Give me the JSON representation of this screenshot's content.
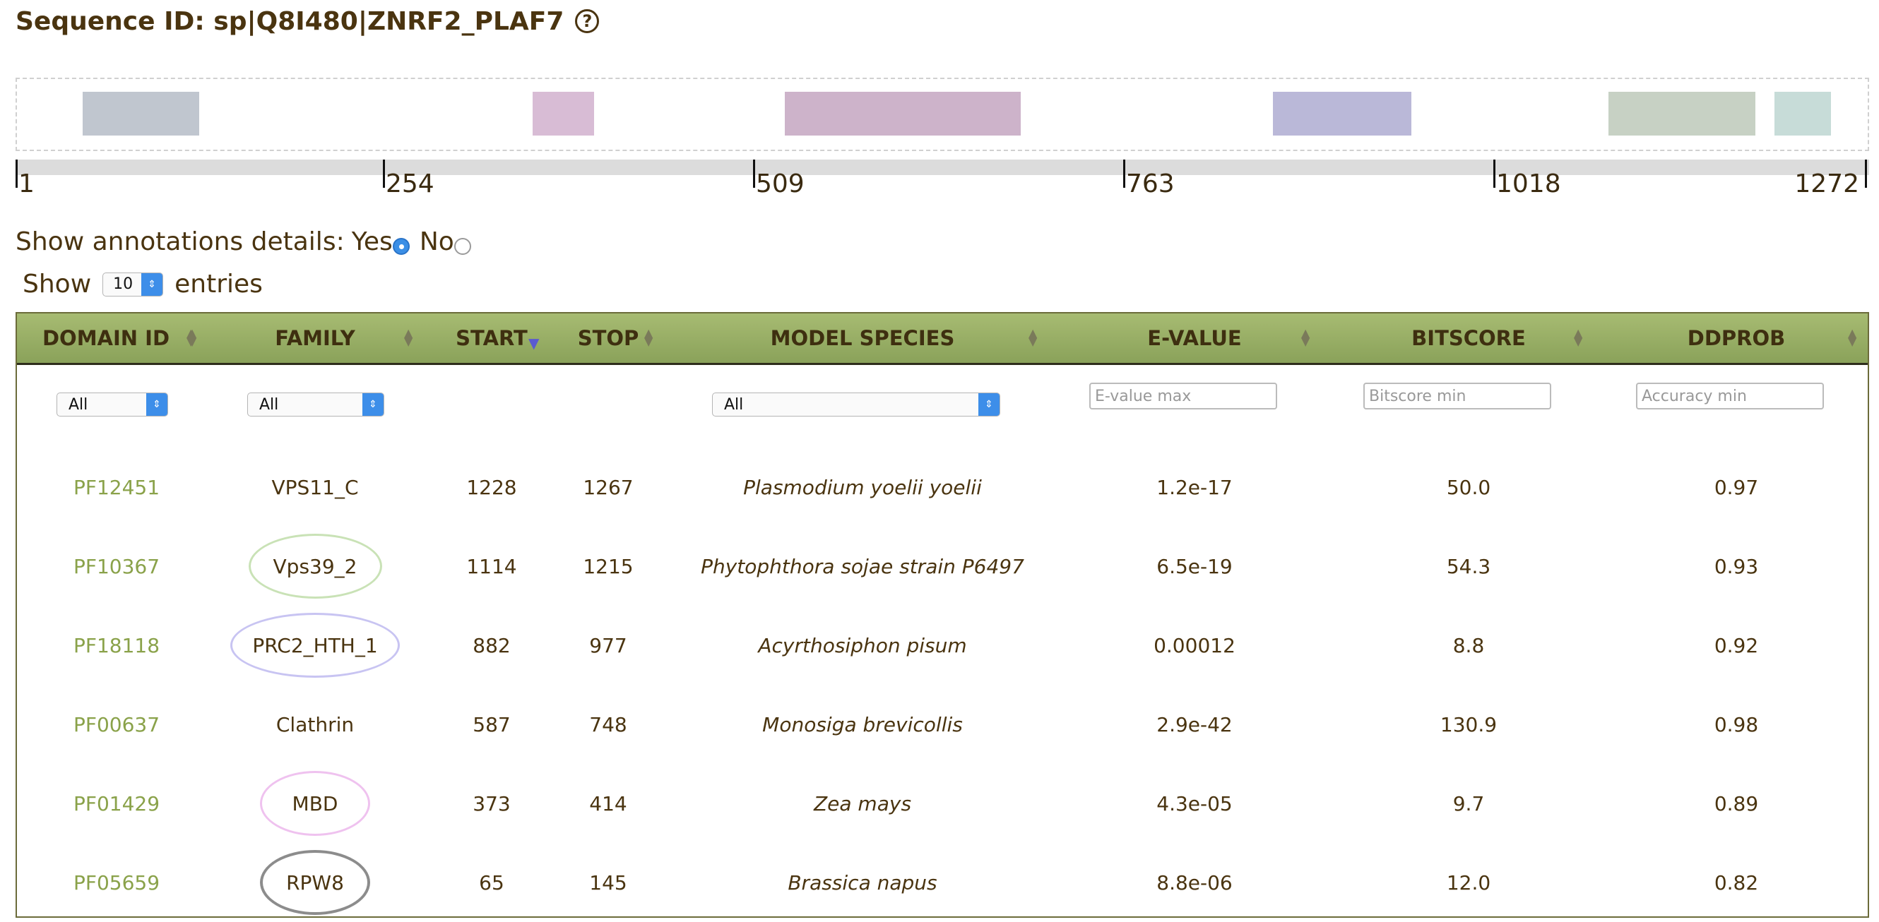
{
  "header": {
    "title": "Sequence ID: sp|Q8I480|ZNRF2_PLAF7",
    "help_icon": "?"
  },
  "domain_map": {
    "blocks": [
      {
        "color": "#c0c6cf",
        "start": 46,
        "end": 126
      },
      {
        "color": "#d8bcd5",
        "start": 355,
        "end": 397
      },
      {
        "color": "#cdb3ca",
        "start": 528,
        "end": 690
      },
      {
        "color": "#bab8d8",
        "start": 863,
        "end": 958
      },
      {
        "color": "#c7d1c4",
        "start": 1093,
        "end": 1194
      },
      {
        "color": "#c7dcd8",
        "start": 1207,
        "end": 1246
      }
    ]
  },
  "ruler": {
    "ticks": [
      "1",
      "254",
      "509",
      "763",
      "1018",
      "1272"
    ]
  },
  "annotations": {
    "label": "Show annotations details:",
    "yes": "Yes",
    "no": "No",
    "selected": "yes"
  },
  "entries": {
    "show": "Show",
    "value": "10",
    "suffix": "entries"
  },
  "table": {
    "columns": [
      "DOMAIN ID",
      "FAMILY",
      "START",
      "STOP",
      "MODEL SPECIES",
      "E-VALUE",
      "BITSCORE",
      "DDPROB"
    ],
    "sorted_column": "START",
    "filters": {
      "domain": "All",
      "family": "All",
      "species": "All",
      "evalue_placeholder": "E-value max",
      "bitscore_placeholder": "Bitscore min",
      "accuracy_placeholder": "Accuracy min"
    },
    "rows": [
      {
        "id": "PF12451",
        "family": "VPS11_C",
        "start": "1228",
        "stop": "1267",
        "species": "Plasmodium yoelii yoelii",
        "evalue": "1.2e-17",
        "bitscore": "50.0",
        "ddprob": "0.97",
        "oval": ""
      },
      {
        "id": "PF10367",
        "family": "Vps39_2",
        "start": "1114",
        "stop": "1215",
        "species": "Phytophthora sojae strain P6497",
        "evalue": "6.5e-19",
        "bitscore": "54.3",
        "ddprob": "0.93",
        "oval": "#c9e2b6"
      },
      {
        "id": "PF18118",
        "family": "PRC2_HTH_1",
        "start": "882",
        "stop": "977",
        "species": "Acyrthosiphon pisum",
        "evalue": "0.00012",
        "bitscore": "8.8",
        "ddprob": "0.92",
        "oval": "#c8c4f2"
      },
      {
        "id": "PF00637",
        "family": "Clathrin",
        "start": "587",
        "stop": "748",
        "species": "Monosiga brevicollis",
        "evalue": "2.9e-42",
        "bitscore": "130.9",
        "ddprob": "0.98",
        "oval": ""
      },
      {
        "id": "PF01429",
        "family": "MBD",
        "start": "373",
        "stop": "414",
        "species": "Zea mays",
        "evalue": "4.3e-05",
        "bitscore": "9.7",
        "ddprob": "0.89",
        "oval": "#efc2ef"
      },
      {
        "id": "PF05659",
        "family": "RPW8",
        "start": "65",
        "stop": "145",
        "species": "Brassica napus",
        "evalue": "8.8e-06",
        "bitscore": "12.0",
        "ddprob": "0.82",
        "oval": "#8c8c8c"
      }
    ]
  }
}
